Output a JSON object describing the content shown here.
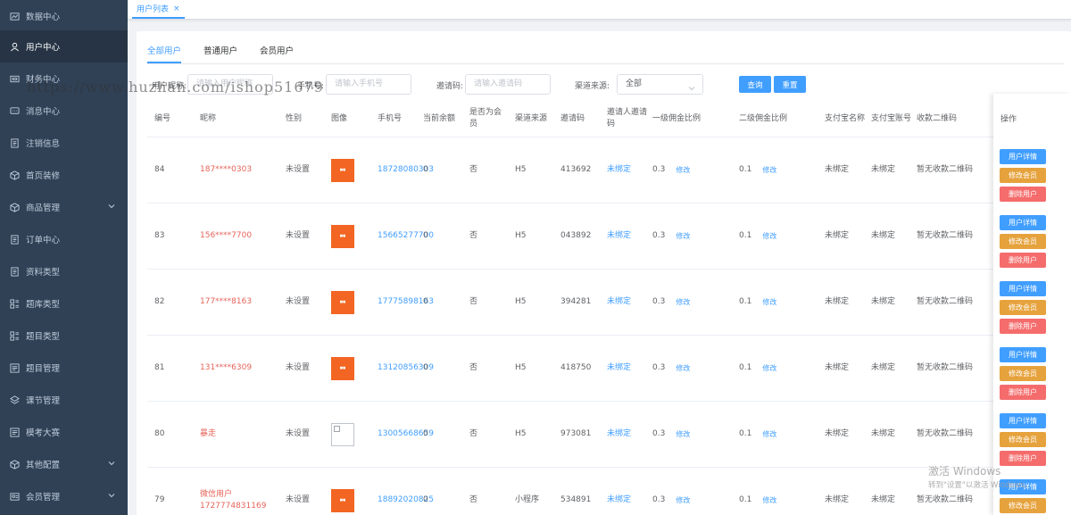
{
  "sidebar": {
    "items": [
      {
        "label": "数据中心",
        "icon": "chart-icon",
        "active": false,
        "chevron": false
      },
      {
        "label": "用户中心",
        "icon": "user-icon",
        "active": true,
        "chevron": false
      },
      {
        "label": "财务中心",
        "icon": "finance-icon",
        "active": false,
        "chevron": false
      },
      {
        "label": "消息中心",
        "icon": "message-icon",
        "active": false,
        "chevron": false
      },
      {
        "label": "注销信息",
        "icon": "document-icon",
        "active": false,
        "chevron": false
      },
      {
        "label": "首页装修",
        "icon": "cube-icon",
        "active": false,
        "chevron": false
      },
      {
        "label": "商品管理",
        "icon": "cube-icon",
        "active": false,
        "chevron": true
      },
      {
        "label": "订单中心",
        "icon": "document-icon",
        "active": false,
        "chevron": false
      },
      {
        "label": "资料类型",
        "icon": "document-icon",
        "active": false,
        "chevron": false
      },
      {
        "label": "题库类型",
        "icon": "grid-icon",
        "active": false,
        "chevron": false
      },
      {
        "label": "题目类型",
        "icon": "grid-icon",
        "active": false,
        "chevron": false
      },
      {
        "label": "题目管理",
        "icon": "list-icon",
        "active": false,
        "chevron": false
      },
      {
        "label": "课节管理",
        "icon": "layers-icon",
        "active": false,
        "chevron": false
      },
      {
        "label": "模考大赛",
        "icon": "list-icon",
        "active": false,
        "chevron": false
      },
      {
        "label": "其他配置",
        "icon": "cube-icon",
        "active": false,
        "chevron": true
      },
      {
        "label": "会员管理",
        "icon": "member-icon",
        "active": false,
        "chevron": true
      }
    ]
  },
  "tabbar": {
    "tab_label": "用户列表",
    "close": "×"
  },
  "subtabs": [
    "全部用户",
    "普通用户",
    "会员用户"
  ],
  "filters": {
    "nickname_label": "用户昵称:",
    "nickname_placeholder": "请输入用户昵称",
    "phone_label": "手机号:",
    "phone_placeholder": "请输入手机号",
    "invite_label": "邀请码:",
    "invite_placeholder": "请输入邀请码",
    "channel_label": "渠道来源:",
    "channel_value": "全部",
    "query_button": "查询",
    "reset_button": "重置"
  },
  "table": {
    "headers": {
      "id": "编号",
      "nickname": "昵称",
      "gender": "性别",
      "avatar": "图像",
      "phone": "手机号",
      "balance": "当前余额",
      "is_member": "是否为会员",
      "channel": "渠道来源",
      "invite_code": "邀请码",
      "inviter_code": "邀请人邀请码",
      "rate1": "一级佣金比例",
      "rate2": "二级佣金比例",
      "alipay_name": "支付宝名称",
      "alipay_account": "支付宝账号",
      "qrcode": "收款二维码",
      "ops": "操作"
    },
    "rows": [
      {
        "id": "84",
        "nickname": "187****0303",
        "gender": "未设置",
        "phone": "18728080303",
        "balance": "0",
        "is_member": "否",
        "channel": "H5",
        "invite_code": "413692",
        "inviter": "未绑定",
        "rate1": "0.3",
        "rate2": "0.1",
        "alipay_name": "未绑定",
        "alipay_account": "未绑定",
        "qrcode": "暂无收款二维码",
        "avatar_broken": false
      },
      {
        "id": "83",
        "nickname": "156****7700",
        "gender": "未设置",
        "phone": "15665277700",
        "balance": "0",
        "is_member": "否",
        "channel": "H5",
        "invite_code": "043892",
        "inviter": "未绑定",
        "rate1": "0.3",
        "rate2": "0.1",
        "alipay_name": "未绑定",
        "alipay_account": "未绑定",
        "qrcode": "暂无收款二维码",
        "avatar_broken": false
      },
      {
        "id": "82",
        "nickname": "177****8163",
        "gender": "未设置",
        "phone": "17775898163",
        "balance": "0",
        "is_member": "否",
        "channel": "H5",
        "invite_code": "394281",
        "inviter": "未绑定",
        "rate1": "0.3",
        "rate2": "0.1",
        "alipay_name": "未绑定",
        "alipay_account": "未绑定",
        "qrcode": "暂无收款二维码",
        "avatar_broken": false
      },
      {
        "id": "81",
        "nickname": "131****6309",
        "gender": "未设置",
        "phone": "13120856309",
        "balance": "0",
        "is_member": "否",
        "channel": "H5",
        "invite_code": "418750",
        "inviter": "未绑定",
        "rate1": "0.3",
        "rate2": "0.1",
        "alipay_name": "未绑定",
        "alipay_account": "未绑定",
        "qrcode": "暂无收款二维码",
        "avatar_broken": false
      },
      {
        "id": "80",
        "nickname": "暴走",
        "gender": "未设置",
        "phone": "13005668659",
        "balance": "0",
        "is_member": "否",
        "channel": "H5",
        "invite_code": "973081",
        "inviter": "未绑定",
        "rate1": "0.3",
        "rate2": "0.1",
        "alipay_name": "未绑定",
        "alipay_account": "未绑定",
        "qrcode": "暂无收款二维码",
        "avatar_broken": true
      },
      {
        "id": "79",
        "nickname": "微信用户1727774831169",
        "gender": "未设置",
        "phone": "18892020825",
        "balance": "0",
        "is_member": "否",
        "channel": "小程序",
        "invite_code": "534891",
        "inviter": "未绑定",
        "rate1": "0.3",
        "rate2": "0.1",
        "alipay_name": "未绑定",
        "alipay_account": "未绑定",
        "qrcode": "暂无收款二维码",
        "avatar_broken": false
      }
    ],
    "edit_link": "修改",
    "op_labels": {
      "detail": "用户详情",
      "member": "修改会员",
      "delete": "删除用户"
    }
  },
  "overlays": {
    "watermark": "https://www.huzhan.com/ishop51679",
    "activate_title": "激活 Windows",
    "activate_sub": "转到\"设置\"以激活 Windows。"
  },
  "colors": {
    "sidebar": "#304156",
    "primary": "#409eff",
    "warning": "#e6a23c",
    "danger": "#f56c6c",
    "nickname": "#e6645a",
    "avatar": "#f26522"
  }
}
